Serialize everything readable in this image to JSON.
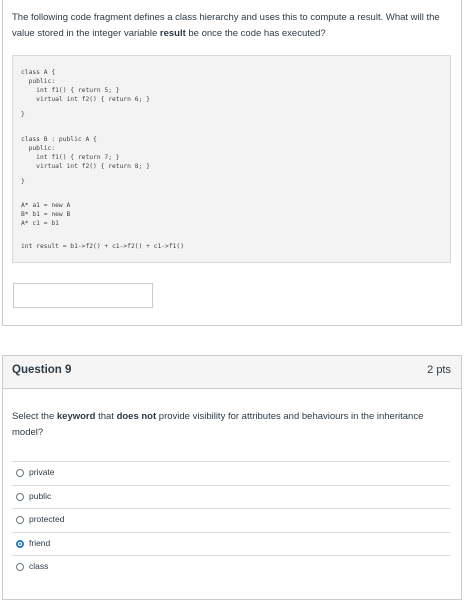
{
  "question8": {
    "prompt_parts": [
      "The following code fragment defines a class hierarchy and uses this to compute a result. What will the value stored in the integer variable ",
      "result",
      " be once the code has executed?"
    ],
    "code_lines": [
      "class A {",
      "  public:",
      "    int f1() { return 5; }",
      "    virtual int f2() { return 6; }",
      "}",
      "class B : public A {",
      "  public:",
      "    int f1() { return 7; }",
      "    virtual int f2() { return 8; }",
      "}",
      "A* a1 = new A",
      "B* b1 = new B",
      "A* c1 = b1",
      "int result = b1->f2() + c1->f2() + c1->f1()"
    ],
    "answer_value": ""
  },
  "question9": {
    "title": "Question 9",
    "points": "2 pts",
    "prompt_parts": [
      "Select the ",
      "keyword",
      " that ",
      "does not",
      " provide visibility for attributes and behaviours in the inheritance model?"
    ],
    "options": [
      "private",
      "public",
      "protected",
      "friend",
      "class"
    ],
    "selected_option": "friend"
  }
}
